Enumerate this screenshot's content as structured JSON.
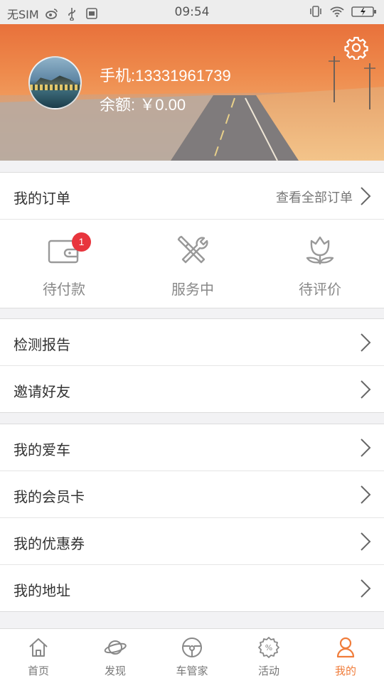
{
  "status_bar": {
    "carrier": "无SIM",
    "time": "09:54",
    "icons": [
      "weibo-icon",
      "usb-icon",
      "notification-icon",
      "vibrate-icon",
      "wifi-icon",
      "battery-charging-icon"
    ]
  },
  "profile": {
    "phone_label": "手机:",
    "phone": "13331961739",
    "balance_label": "余额: ",
    "balance": "￥0.00",
    "settings_icon": "gear-icon"
  },
  "orders": {
    "title": "我的订单",
    "view_all": "查看全部订单",
    "statuses": [
      {
        "label": "待付款",
        "icon": "wallet-icon",
        "badge": "1"
      },
      {
        "label": "服务中",
        "icon": "tools-icon"
      },
      {
        "label": "待评价",
        "icon": "flower-icon"
      }
    ]
  },
  "menu_group_1": [
    {
      "label": "检测报告"
    },
    {
      "label": "邀请好友"
    }
  ],
  "menu_group_2": [
    {
      "label": "我的爱车"
    },
    {
      "label": "我的会员卡"
    },
    {
      "label": "我的优惠券"
    },
    {
      "label": "我的地址"
    }
  ],
  "tabbar": {
    "active": "我的",
    "items": [
      {
        "label": "首页",
        "icon": "home-icon"
      },
      {
        "label": "发现",
        "icon": "planet-icon"
      },
      {
        "label": "车管家",
        "icon": "steering-wheel-icon"
      },
      {
        "label": "活动",
        "icon": "discount-badge-icon"
      },
      {
        "label": "我的",
        "icon": "person-icon"
      }
    ]
  },
  "colors": {
    "accent": "#f07c3a",
    "badge": "#e8353d",
    "header_top": "#e8713b",
    "background": "#f2f2f4"
  }
}
